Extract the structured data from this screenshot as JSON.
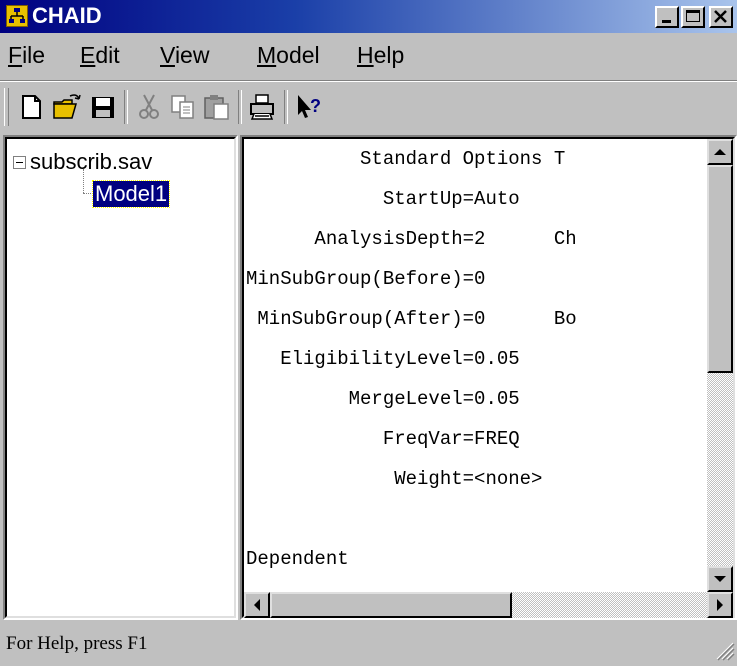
{
  "window": {
    "title": "CHAID"
  },
  "menu": {
    "items": [
      {
        "label": "File",
        "u": "F",
        "rest": "ile"
      },
      {
        "label": "Edit",
        "u": "E",
        "rest": "dit"
      },
      {
        "label": "View",
        "u": "V",
        "rest": "iew"
      },
      {
        "label": "Model",
        "u": "M",
        "rest": "odel"
      },
      {
        "label": "Help",
        "u": "H",
        "rest": "elp"
      }
    ]
  },
  "toolbar": {
    "icons": [
      "new-file-icon",
      "open-folder-icon",
      "save-icon",
      "cut-icon",
      "copy-icon",
      "paste-icon",
      "print-icon",
      "help-pointer-icon"
    ]
  },
  "tree": {
    "root": "subscrib.sav",
    "child": "Model1"
  },
  "content": {
    "lines": [
      "          Standard Options T",
      "            StartUp=Auto",
      "      AnalysisDepth=2      Ch",
      "MinSubGroup(Before)=0",
      " MinSubGroup(After)=0      Bo",
      "   EligibilityLevel=0.05",
      "         MergeLevel=0.05",
      "            FreqVar=FREQ",
      "             Weight=<none>",
      "",
      "Dependent"
    ]
  },
  "status": {
    "text": "For Help, press F1"
  },
  "colors": {
    "titlebar_start": "#000080",
    "titlebar_end": "#a9c4ec",
    "selection": "#000080",
    "face": "#c0c0c0"
  }
}
